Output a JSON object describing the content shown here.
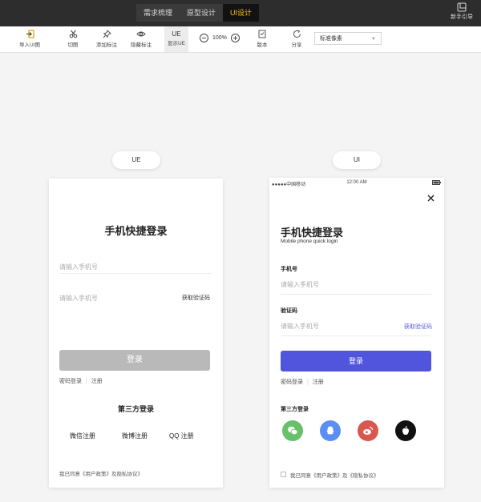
{
  "topbar": {
    "tabs": [
      "需求梳理",
      "原型设计",
      "UI设计"
    ],
    "active_tab": "UI设计",
    "guide_label": "新手引导"
  },
  "toolbar": {
    "import_label": "导入UI图",
    "cut_label": "切图",
    "add_marker_label": "添加标注",
    "hide_marker_label": "隐藏标注",
    "ue_label": "UE",
    "show_ue_label": "显示UE",
    "zoom": "100%",
    "version_label": "版本",
    "share_label": "分享",
    "pixel_select": "标准像素"
  },
  "ue_panel": {
    "pill": "UE",
    "title": "手机快捷登录",
    "phone_placeholder": "请输入手机号",
    "code_placeholder": "请输入手机号",
    "get_code": "获取验证码",
    "login_button": "登录",
    "pwd_login": "密码登录",
    "divider": "|",
    "register": "注册",
    "third_title": "第三方登录",
    "wechat": "微信注册",
    "weibo": "微博注册",
    "qq": "QQ 注册",
    "agreement": "我已同意《用户政策》及隐私协议》"
  },
  "ui_panel": {
    "pill": "UI",
    "carrier": "●●●●●中国移动",
    "time": "12:00 AM",
    "title": "手机快捷登录",
    "subtitle": "Mobile phone quick login",
    "phone_label": "手机号",
    "phone_placeholder": "请输入手机号",
    "code_label": "验证码",
    "code_placeholder": "请输入手机号",
    "get_code": "获取验证码",
    "login_button": "登录",
    "pwd_login": "密码登录",
    "divider": "|",
    "register": "注册",
    "third_title": "第三方登录",
    "agreement": "我已同意《用户政策》及《隐私协议》"
  },
  "colors": {
    "accent": "#5155dd",
    "ue_button": "#b9b9b9",
    "wechat": "#67c06a",
    "qq": "#5b8ef5",
    "weibo": "#d9574e",
    "apple": "#111111",
    "tab_active": "#f5c518"
  },
  "icons": [
    "import-icon",
    "scissors-icon",
    "pin-icon",
    "eye-icon",
    "version-icon",
    "share-icon",
    "guide-icon",
    "close-icon",
    "wechat-icon",
    "qq-icon",
    "weibo-icon",
    "apple-icon",
    "battery-icon"
  ]
}
